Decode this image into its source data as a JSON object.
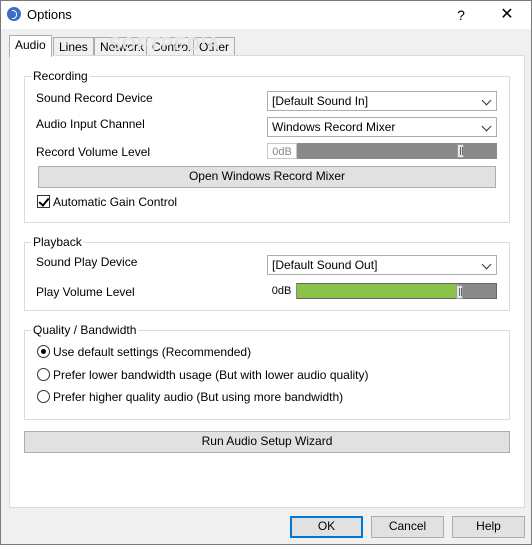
{
  "window": {
    "title": "Options",
    "help_symbol": "?",
    "close_symbol": "✕"
  },
  "watermark": "SOFTPEDIA",
  "tabs": [
    {
      "label": "Audio",
      "active": true
    },
    {
      "label": "Lines"
    },
    {
      "label": "Network"
    },
    {
      "label": "Control"
    },
    {
      "label": "Other"
    }
  ],
  "recording": {
    "title": "Recording",
    "device_label": "Sound Record Device",
    "device_value": "[Default Sound In]",
    "channel_label": "Audio Input Channel",
    "channel_value": "Windows Record Mixer",
    "volume_label": "Record Volume Level",
    "volume_value": "0dB",
    "volume_level": 0.85,
    "volume_enabled": false,
    "open_mixer_button": "Open Windows Record Mixer",
    "agc_label": "Automatic Gain Control",
    "agc_checked": true
  },
  "playback": {
    "title": "Playback",
    "device_label": "Sound Play Device",
    "device_value": "[Default Sound Out]",
    "volume_label": "Play Volume Level",
    "volume_value": "0dB",
    "volume_level": 0.85
  },
  "quality": {
    "title": "Quality / Bandwidth",
    "options": [
      {
        "label": "Use default settings (Recommended)",
        "checked": true
      },
      {
        "label": "Prefer lower bandwidth usage (But with lower audio quality)",
        "checked": false
      },
      {
        "label": "Prefer higher quality audio (But using more bandwidth)",
        "checked": false
      }
    ]
  },
  "wizard_button": "Run Audio Setup Wizard",
  "footer": {
    "ok": "OK",
    "cancel": "Cancel",
    "help": "Help"
  },
  "colors": {
    "play_fill": "#8bc34a",
    "record_track": "#888888",
    "accent": "#0078d7"
  }
}
